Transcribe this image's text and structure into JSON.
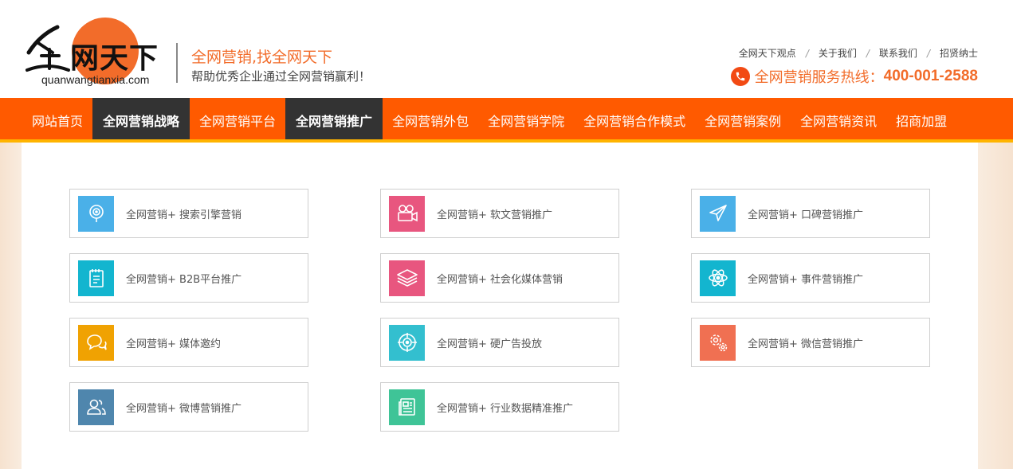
{
  "header": {
    "logo_domain": "quanwangtianxia.com",
    "logo_text": "网天下",
    "slogan": "全网营销,找全网天下",
    "subslogan": "帮助优秀企业通过全网营销赢利！",
    "top_links": [
      "全网天下观点",
      "关于我们",
      "联系我们",
      "招贤纳士"
    ],
    "hotline_label": "全网营销服务热线：",
    "hotline_number": "400-001-2588"
  },
  "nav": {
    "items": [
      {
        "label": "网站首页",
        "active": false
      },
      {
        "label": "全网营销战略",
        "active": true
      },
      {
        "label": "全网营销平台",
        "active": false
      },
      {
        "label": "全网营销推广",
        "active": true
      },
      {
        "label": "全网营销外包",
        "active": false
      },
      {
        "label": "全网营销学院",
        "active": false
      },
      {
        "label": "全网营销合作模式",
        "active": false
      },
      {
        "label": "全网营销案例",
        "active": false
      },
      {
        "label": "全网营销资讯",
        "active": false
      },
      {
        "label": "招商加盟",
        "active": false
      }
    ]
  },
  "cards": [
    {
      "label": "全网营销+ 搜索引擎营销",
      "icon": "search-engine-icon",
      "color": "#4ab0e8"
    },
    {
      "label": "全网营销+ 软文营销推广",
      "icon": "video-camera-icon",
      "color": "#e8567f"
    },
    {
      "label": "全网营销+ 口碑营销推广",
      "icon": "paper-plane-icon",
      "color": "#4ab0e8"
    },
    {
      "label": "全网营销+ B2B平台推广",
      "icon": "notepad-icon",
      "color": "#13b5cf"
    },
    {
      "label": "全网营销+ 社会化媒体营销",
      "icon": "layers-icon",
      "color": "#e8567f"
    },
    {
      "label": "全网营销+ 事件营销推广",
      "icon": "atom-icon",
      "color": "#13b5cf"
    },
    {
      "label": "全网营销+ 媒体邀约",
      "icon": "chat-bubbles-icon",
      "color": "#f0a202"
    },
    {
      "label": "全网营销+ 硬广告投放",
      "icon": "target-icon",
      "color": "#33bfcf"
    },
    {
      "label": "全网营销+ 微信营销推广",
      "icon": "gears-icon",
      "color": "#f07052"
    },
    {
      "label": "全网营销+ 微博营销推广",
      "icon": "users-icon",
      "color": "#4f86ad"
    },
    {
      "label": "全网营销+ 行业数据精准推广",
      "icon": "newspaper-icon",
      "color": "#3fc497"
    }
  ]
}
